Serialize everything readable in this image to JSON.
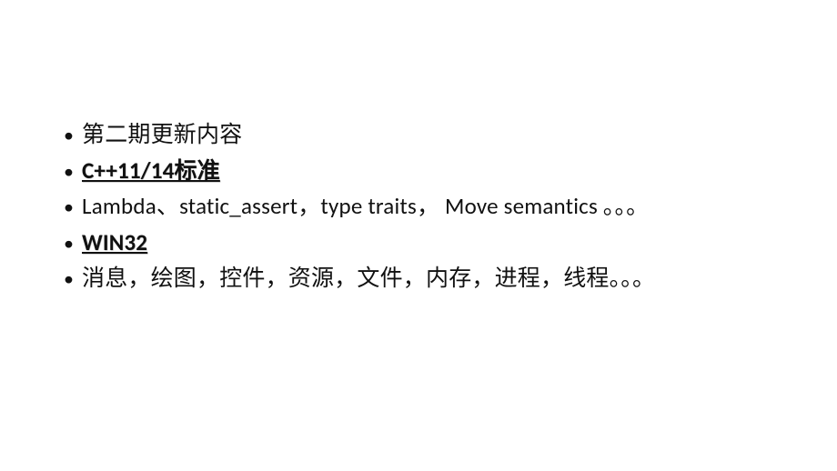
{
  "bullets": [
    {
      "text": "第二期更新内容",
      "emph": false
    },
    {
      "text": "C++11/14标准",
      "emph": true
    },
    {
      "text": "Lambda、static_assert，type traits， Move semantics 。。。",
      "emph": false
    },
    {
      "text": "WIN32",
      "emph": true
    },
    {
      "text": "消息，绘图，控件，资源，文件，内存，进程，线程。。。",
      "emph": false
    }
  ]
}
